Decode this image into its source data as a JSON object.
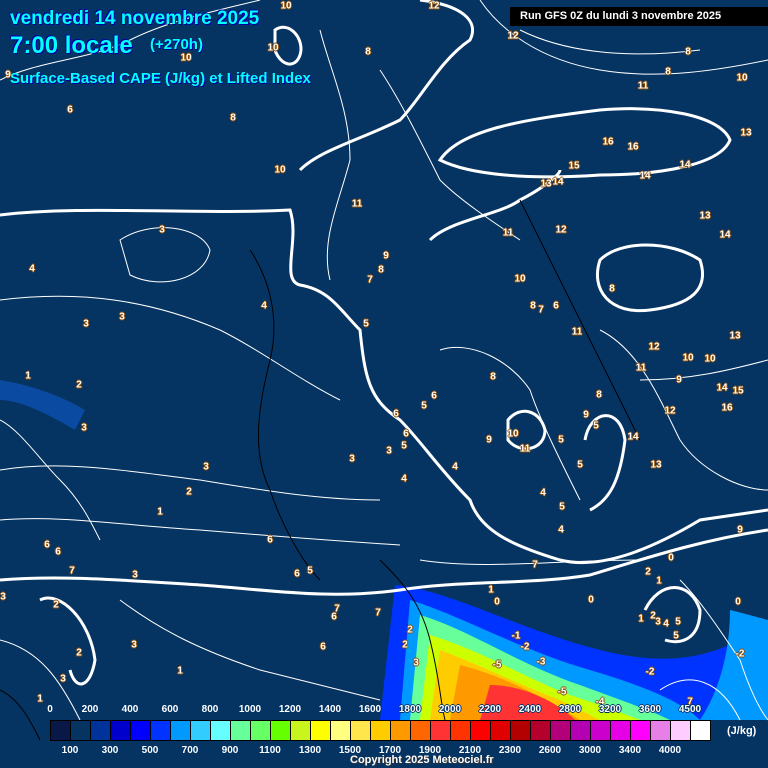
{
  "header": {
    "date": "vendredi 14 novembre 2025",
    "time": "7:00 locale",
    "lead": "(+270h)",
    "product": "Surface-Based CAPE (J/kg) et Lifted Index",
    "run": "Run GFS 0Z du lundi 3 novembre 2025"
  },
  "legend": {
    "top_ticks": [
      "0",
      "200",
      "400",
      "600",
      "800",
      "1000",
      "1200",
      "1400",
      "1600",
      "1800",
      "2000",
      "2200",
      "2400",
      "2800",
      "3200",
      "3600",
      "4500"
    ],
    "bottom_ticks": [
      "100",
      "300",
      "500",
      "700",
      "900",
      "1100",
      "1300",
      "1500",
      "1700",
      "1900",
      "2100",
      "2300",
      "2600",
      "3000",
      "3400",
      "4000"
    ],
    "unit": "(J/kg)",
    "colors": [
      "#0a1848",
      "#063462",
      "#003399",
      "#0000cc",
      "#0000ff",
      "#0033ff",
      "#0099ff",
      "#33ccff",
      "#66ffff",
      "#66ff99",
      "#66ff66",
      "#66ff00",
      "#c8f51e",
      "#ffff00",
      "#ffff80",
      "#ffe64d",
      "#ffcc00",
      "#ff9900",
      "#ff6600",
      "#ff3333",
      "#ff3300",
      "#ff0000",
      "#e00000",
      "#b30000",
      "#b3002d",
      "#b3007a",
      "#b300b3",
      "#cc00cc",
      "#e600e6",
      "#ff00ff",
      "#e680e6",
      "#ffccff",
      "#ffffff"
    ]
  },
  "contour_labels": [
    "12",
    "10",
    "12",
    "8",
    "8",
    "10",
    "10",
    "9",
    "6",
    "8",
    "11",
    "8",
    "10",
    "13",
    "16",
    "16",
    "15",
    "14",
    "14",
    "13",
    "14",
    "10",
    "11",
    "13",
    "14",
    "12",
    "11",
    "3",
    "4",
    "9",
    "8",
    "7",
    "10",
    "8",
    "6",
    "7",
    "8",
    "4",
    "3",
    "3",
    "5",
    "11",
    "13",
    "12",
    "10",
    "10",
    "9",
    "11",
    "1",
    "2",
    "8",
    "14",
    "15",
    "8",
    "6",
    "5",
    "12",
    "16",
    "3",
    "6",
    "6",
    "9",
    "5",
    "10",
    "9",
    "5",
    "14",
    "3",
    "5",
    "11",
    "5",
    "4",
    "4",
    "3",
    "3",
    "13",
    "2",
    "5",
    "4",
    "1",
    "4",
    "9",
    "6",
    "6",
    "6",
    "7",
    "0",
    "6",
    "5",
    "2",
    "1",
    "7",
    "3",
    "3",
    "1",
    "0",
    "0",
    "0",
    "2",
    "7",
    "7",
    "6",
    "1",
    "2",
    "3",
    "4",
    "5",
    "5",
    "2",
    "3",
    "6",
    "2",
    "2",
    "3",
    "-1",
    "-2",
    "-2",
    "-3",
    "-5",
    "-2",
    "1",
    "3",
    "1",
    "-5",
    "-4",
    "7"
  ],
  "copyright": "Copyright 2025 Meteociel.fr"
}
